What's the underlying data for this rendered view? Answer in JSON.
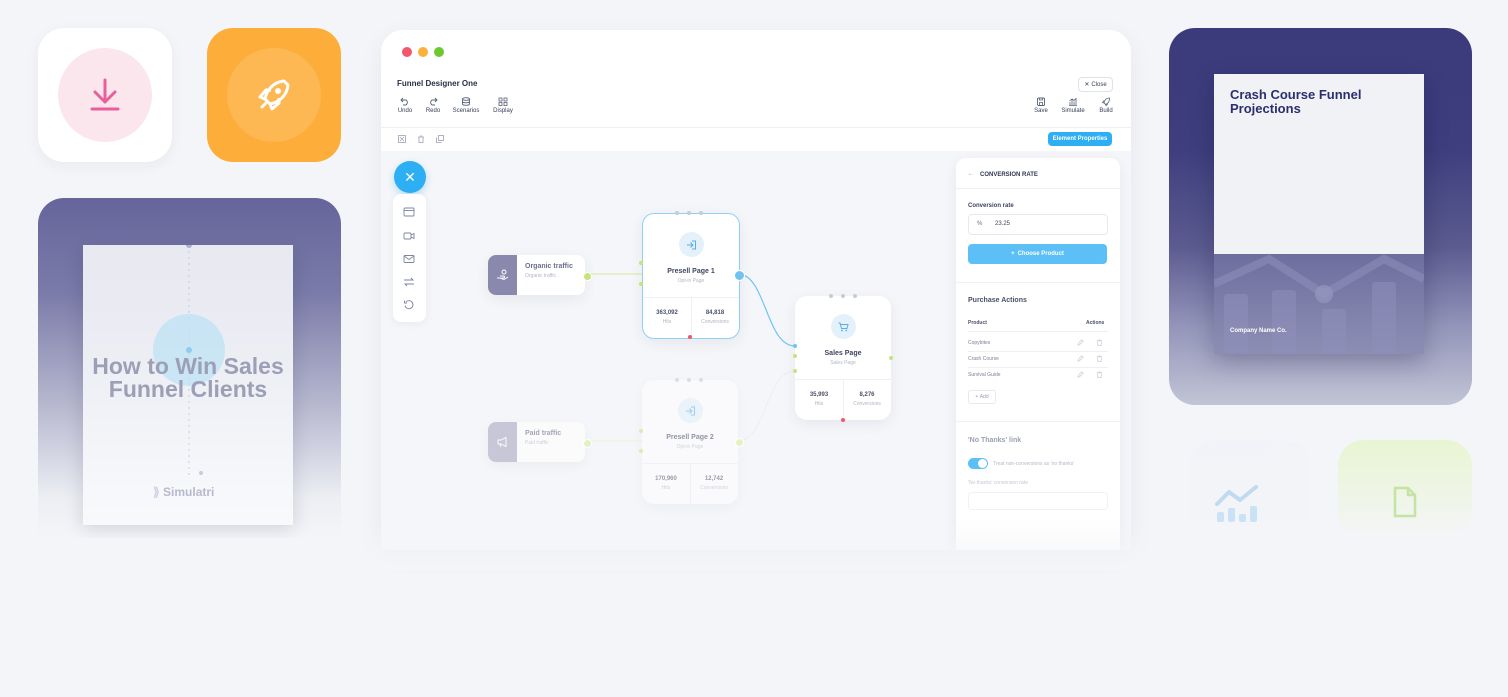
{
  "colors": {
    "accent": "#2eaef3",
    "orange": "#fdae3a",
    "book_navy": "#3b3b7c",
    "traffic_red": "#f0596a",
    "traffic_yellow": "#fbb13c",
    "traffic_green": "#6dc82f"
  },
  "icons": [
    "download-icon",
    "rocket-icon",
    "close-icon",
    "undo-icon",
    "redo-icon",
    "scenarios-icon",
    "display-icon",
    "save-icon",
    "simulate-icon",
    "build-icon",
    "cart-icon",
    "login-icon",
    "hand-money-icon",
    "megaphone-icon",
    "chart-icon",
    "document-icon"
  ],
  "ebook": {
    "title": "How to Win Sales Funnel Clients",
    "brand": "Simulatri"
  },
  "window": {
    "title": "Funnel Designer One",
    "close_label": "Close",
    "toolbar": {
      "undo": "Undo",
      "redo": "Redo",
      "scenarios": "Scenarios",
      "display": "Display",
      "save": "Save",
      "simulate": "Simulate",
      "build": "Build"
    },
    "element_properties": "Element Properties"
  },
  "nodes": {
    "organic": {
      "title": "Organic traffic",
      "subtitle": "Organic traffic"
    },
    "paid": {
      "title": "Paid traffic",
      "subtitle": "Paid traffic"
    },
    "presell1": {
      "title": "Presell Page 1",
      "subtitle": "Opt-in Page",
      "hits": "363,092",
      "hits_label": "Hits",
      "conv": "84,818",
      "conv_label": "Conversions"
    },
    "presell2": {
      "title": "Presell Page 2",
      "subtitle": "Opt-in Page",
      "hits": "170,960",
      "hits_label": "Hits",
      "conv": "12,742",
      "conv_label": "Conversions"
    },
    "sales": {
      "title": "Sales Page",
      "subtitle": "Sales Page",
      "hits": "35,993",
      "hits_label": "Hits",
      "conv": "8,276",
      "conv_label": "Conversions"
    }
  },
  "panel": {
    "heading": "CONVERSION RATE",
    "field_label": "Conversion rate",
    "field_prefix": "%",
    "field_value": "23.25",
    "choose_button": "Choose Product",
    "purchase_heading": "Purchase Actions",
    "col_product": "Product",
    "col_actions": "Actions",
    "products": [
      "Copybites",
      "Crash Course",
      "Survival Guide"
    ],
    "add_label": "Add",
    "no_thanks_heading": "'No Thanks' link",
    "toggle_label": "Treat non-conversions as 'no thanks'",
    "no_thanks_rate_label": "'No thanks' conversion rate",
    "toggle_on": true
  },
  "book": {
    "title": "Crash Course Funnel Projections",
    "company": "Company Name Co."
  }
}
